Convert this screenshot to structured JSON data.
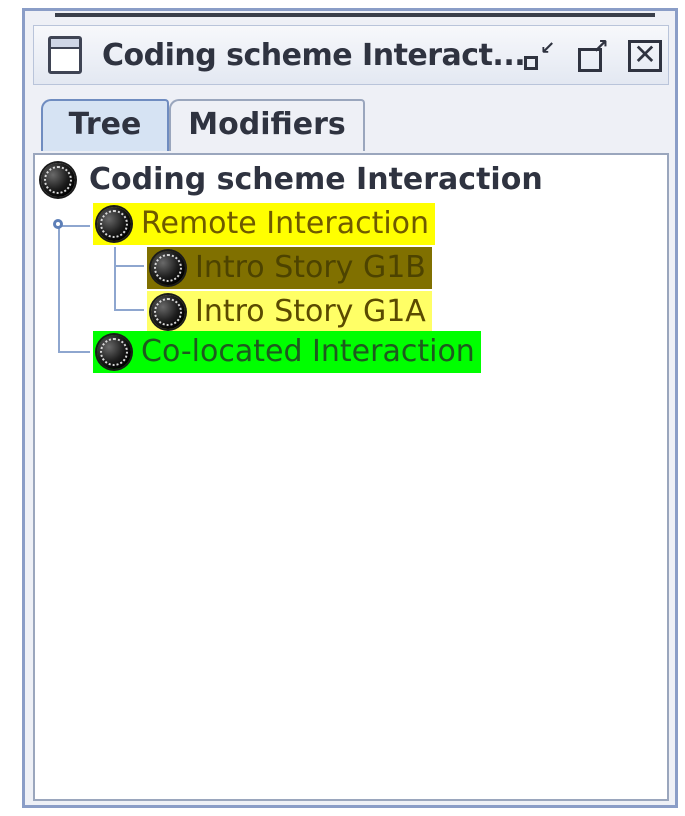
{
  "window": {
    "title": "Coding scheme Interact...",
    "icons": {
      "window": "window-icon",
      "minimize": "minimize-icon",
      "maximize": "maximize-icon",
      "close": "close-icon"
    }
  },
  "tabs": [
    {
      "label": "Tree",
      "selected": true
    },
    {
      "label": "Modifiers",
      "selected": false
    }
  ],
  "tree": {
    "root": {
      "label": "Coding scheme Interaction",
      "icon": "node-ball-icon"
    },
    "children": [
      {
        "label": "Remote Interaction",
        "color": "#ffff00",
        "expanded": true,
        "children": [
          {
            "label": "Intro Story G1B",
            "color": "#807000",
            "text_color": "#4d4300"
          },
          {
            "label": "Intro Story G1A",
            "color": "#ffff66",
            "text_color": "#5a4a00"
          }
        ]
      },
      {
        "label": "Co-located Interaction",
        "color": "#00ff00"
      }
    ]
  },
  "colors": {
    "window_border": "#8a9dc7",
    "tab_selected": "#d6e3f3",
    "tree_line": "#8ea6cf"
  }
}
